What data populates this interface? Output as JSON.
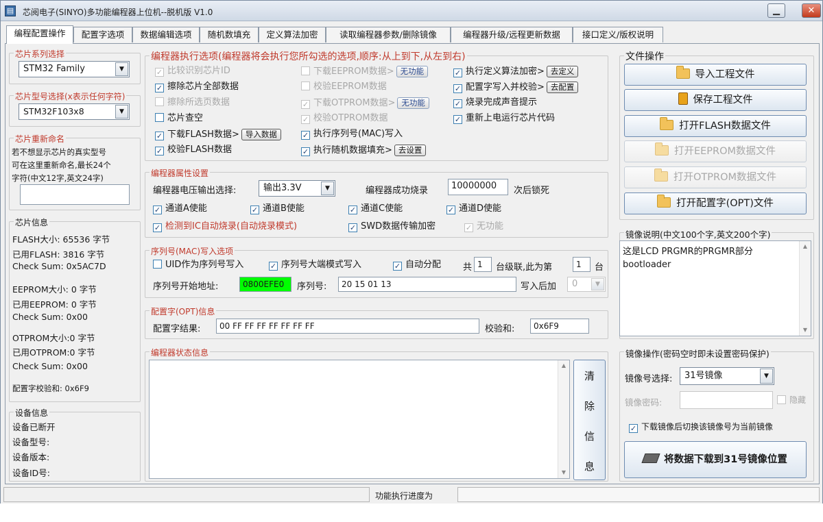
{
  "window": {
    "title": "芯阅电子(SINYO)多功能编程器上位机--脱机版 V1.0",
    "minimize_glyph": "▁",
    "close_glyph": "✕"
  },
  "tabs": [
    {
      "label": "编程配置操作",
      "active": true
    },
    {
      "label": "配置字选项"
    },
    {
      "label": "数据编辑选项"
    },
    {
      "label": "随机数填充"
    },
    {
      "label": "定义算法加密"
    },
    {
      "label": "读取编程器参数/删除镜像"
    },
    {
      "label": "编程器升级/远程更新数据"
    },
    {
      "label": "接口定义/版权说明"
    }
  ],
  "chip_family": {
    "legend": "芯片系列选择",
    "value": "STM32 Family"
  },
  "chip_model": {
    "legend": "芯片型号选择(x表示任何字符)",
    "value": "STM32F103x8"
  },
  "chip_rename": {
    "legend": "芯片重新命名",
    "desc": [
      "若不想显示芯片的真实型号",
      "可在这里重新命名,最长24个",
      "字符(中文12字,英文24字)"
    ],
    "value": ""
  },
  "chip_info": {
    "legend": "芯片信息",
    "lines": [
      "FLASH大小:    65536 字节",
      "已用FLASH:    3816 字节",
      "Check Sum: 0x5AC7D",
      "EEPROM大小: 0 字节",
      "已用EEPROM: 0 字节",
      "Check Sum: 0x00",
      "OTPROM大小:0 字节",
      "已用OTPROM:0 字节",
      "Check Sum: 0x00",
      "配置字校验和: 0x6F9"
    ]
  },
  "device_info": {
    "legend": "设备信息",
    "lines": [
      "设备已断开",
      "设备型号:",
      "设备版本:",
      "设备ID号:"
    ]
  },
  "exec_options": {
    "legend": "编程器执行选项(编程器将会执行您所勾选的选项,顺序:从上到下,从左到右)",
    "col1": [
      {
        "label": "比较识别芯片ID",
        "checked": true,
        "disabled": true
      },
      {
        "label": "擦除芯片全部数据",
        "checked": true
      },
      {
        "label": "擦除所选页数据",
        "checked": false,
        "disabled": true
      },
      {
        "label": "芯片查空",
        "checked": false
      },
      {
        "label": "下载FLASH数据>",
        "checked": true,
        "button": "导入数据"
      },
      {
        "label": "校验FLASH数据",
        "checked": true
      }
    ],
    "col2": [
      {
        "label": "下载EEPROM数据>",
        "checked": false,
        "disabled": true,
        "button": "无功能"
      },
      {
        "label": "校验EEPROM数据",
        "checked": false,
        "disabled": true
      },
      {
        "label": "下载OTPROM数据>",
        "checked": true,
        "disabled": true,
        "button": "无功能"
      },
      {
        "label": "校验OTPROM数据",
        "checked": true,
        "disabled": true
      },
      {
        "label": "执行序列号(MAC)写入",
        "checked": true
      },
      {
        "label": "执行随机数据填充>",
        "checked": true,
        "button": "去设置"
      }
    ],
    "col3": [
      {
        "label": "执行定义算法加密>",
        "checked": true,
        "button": "去定义"
      },
      {
        "label": "配置字写入并校验>",
        "checked": true,
        "button": "去配置"
      },
      {
        "label": "烧录完成声音提示",
        "checked": true
      },
      {
        "label": "重新上电运行芯片代码",
        "checked": true
      }
    ]
  },
  "props": {
    "legend": "编程器属性设置",
    "voltage_label": "编程器电压输出选择:",
    "voltage_value": "输出3.3V",
    "success_label": "编程器成功烧录",
    "success_value": "10000000",
    "lock_label": "次后锁死",
    "channels": [
      {
        "label": "通道A使能",
        "checked": true
      },
      {
        "label": "通道B使能",
        "checked": true
      },
      {
        "label": "通道C使能",
        "checked": true
      },
      {
        "label": "通道D使能",
        "checked": true
      }
    ],
    "auto_burn": {
      "label": "检测到IC自动烧录(自动烧录模式)",
      "checked": true
    },
    "swd_encrypt": {
      "label": "SWD数据传输加密",
      "checked": true
    },
    "no_func": {
      "label": "无功能",
      "checked": true
    }
  },
  "serial": {
    "legend": "序列号(MAC)写入选项",
    "uid": {
      "label": "UID作为序列号写入",
      "checked": false
    },
    "big_endian": {
      "label": "序列号大端模式写入",
      "checked": true
    },
    "auto_assign": {
      "label": "自动分配",
      "checked": true
    },
    "total_label": "共",
    "total_value": "1",
    "cascade_label": "台级联,此为第",
    "index_value": "1",
    "unit_label": "台",
    "start_addr_label": "序列号开始地址:",
    "start_addr_value": "0800EFE0",
    "accent": "#00ff00",
    "serial_label": "序列号:",
    "serial_value": "20 15 01 13",
    "after_label": "写入后加",
    "after_value": "0"
  },
  "opt": {
    "legend": "配置字(OPT)信息",
    "result_label": "配置字结果:",
    "result_value": "00 FF FF FF FF FF FF FF",
    "checksum_label": "校验和:",
    "checksum_value": "0x6F9"
  },
  "status": {
    "legend": "编程器状态信息",
    "content": "",
    "clear_button": [
      "清",
      "除",
      "信",
      "息"
    ]
  },
  "file_ops": {
    "legend": "文件操作",
    "buttons": [
      {
        "label": "导入工程文件",
        "icon": "folder-icon",
        "enabled": true
      },
      {
        "label": "保存工程文件",
        "icon": "save-icon",
        "enabled": true
      },
      {
        "label": "打开FLASH数据文件",
        "icon": "folder-icon",
        "enabled": true
      },
      {
        "label": "打开EEPROM数据文件",
        "icon": "folder-icon",
        "enabled": false
      },
      {
        "label": "打开OTPROM数据文件",
        "icon": "folder-icon",
        "enabled": false
      },
      {
        "label": "打开配置字(OPT)文件",
        "icon": "folder-icon",
        "enabled": true
      }
    ]
  },
  "image_desc": {
    "legend": "镜像说明(中文100个字,英文200个字)",
    "lines": [
      "这是LCD PRGMR的PRGMR部分",
      "bootloader"
    ]
  },
  "image_ops": {
    "legend": "镜像操作(密码空时即未设置密码保护)",
    "select_label": "镜像号选择:",
    "select_value": "31号镜像",
    "password_label": "镜像密码:",
    "password_value": "",
    "hide_label": "隐藏",
    "switch_label": "下载镜像后切换该镜像号为当前镜像",
    "switch_checked": true,
    "download_button": "将数据下载到31号镜像位置"
  },
  "statusbar": {
    "progress_label": "功能执行进度为",
    "progress": 0
  }
}
